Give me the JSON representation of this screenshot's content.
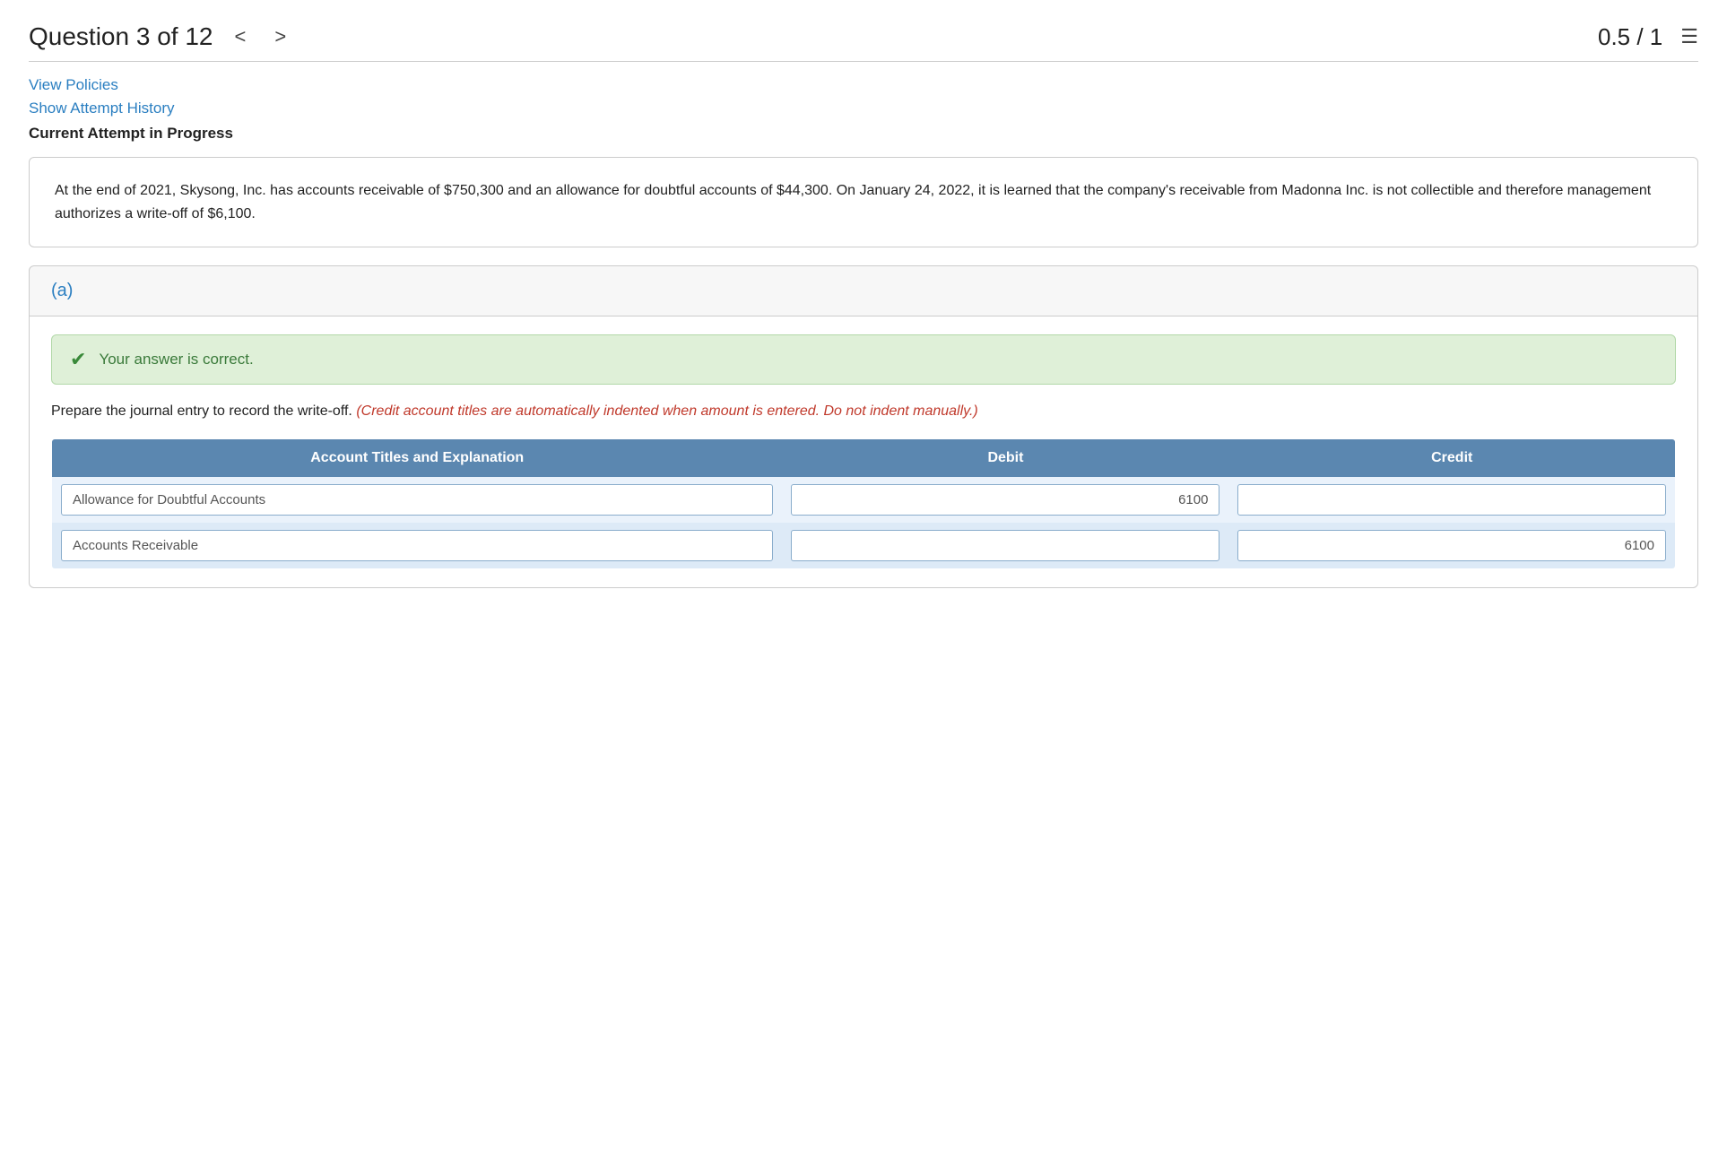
{
  "header": {
    "question_label": "Question 3 of 12",
    "nav_prev": "<",
    "nav_next": ">",
    "score": "0.5 / 1",
    "menu_icon": "☰"
  },
  "links": {
    "view_policies": "View Policies",
    "show_attempt_history": "Show Attempt History"
  },
  "current_attempt": "Current Attempt in Progress",
  "question_text": "At the end of 2021, Skysong, Inc. has accounts receivable of $750,300 and an allowance for doubtful accounts of $44,300. On January 24, 2022, it is learned that the company's receivable from Madonna Inc. is not collectible and therefore management authorizes a write-off of $6,100.",
  "part": {
    "label": "(a)",
    "correct_banner": "Your answer is correct.",
    "instruction_static": "Prepare the journal entry to record the write-off.",
    "instruction_italic": "(Credit account titles are automatically indented when amount is entered. Do not indent manually.)",
    "table": {
      "headers": [
        "Account Titles and Explanation",
        "Debit",
        "Credit"
      ],
      "rows": [
        {
          "account": "Allowance for Doubtful Accounts",
          "debit": "6100",
          "credit": ""
        },
        {
          "account": "Accounts Receivable",
          "debit": "",
          "credit": "6100"
        }
      ]
    }
  }
}
